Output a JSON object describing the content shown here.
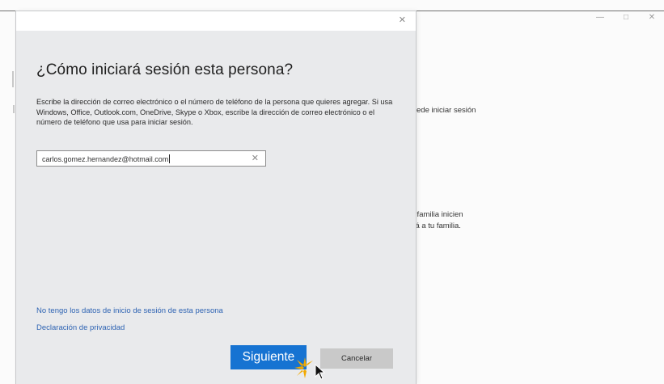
{
  "background": {
    "window_controls": [
      "—",
      "□",
      "✕"
    ],
    "text_1": "ede iniciar sesión",
    "text_2": "tu familia inicien",
    "text_3": "ará a tu familia."
  },
  "dialog": {
    "close_glyph": "✕",
    "title": "¿Cómo iniciará sesión esta persona?",
    "description": "Escribe la dirección de correo electrónico o el número de teléfono de la persona que quieres agregar. Si usa Windows, Office, Outlook.com, OneDrive, Skype o Xbox, escribe la dirección de correo electrónico o el número de teléfono que usa para iniciar sesión.",
    "email": {
      "value": "carlos.gomez.hernandez@hotmail.com",
      "clear_glyph": "✕"
    },
    "links": {
      "no_data": "No tengo los datos de inicio de sesión de esta persona",
      "privacy": "Declaración de privacidad"
    },
    "buttons": {
      "next": "Siguiente",
      "cancel": "Cancelar"
    }
  },
  "colors": {
    "accent": "#1673d2",
    "link": "#2f64b3",
    "dialog_bg": "#e9eaec",
    "cancel_bg": "#c9c9c9",
    "burst": "#f2a900"
  },
  "icons": {
    "close": "close-icon",
    "clear": "clear-text-icon",
    "cursor": "mouse-cursor-icon",
    "burst": "click-highlight-icon"
  }
}
